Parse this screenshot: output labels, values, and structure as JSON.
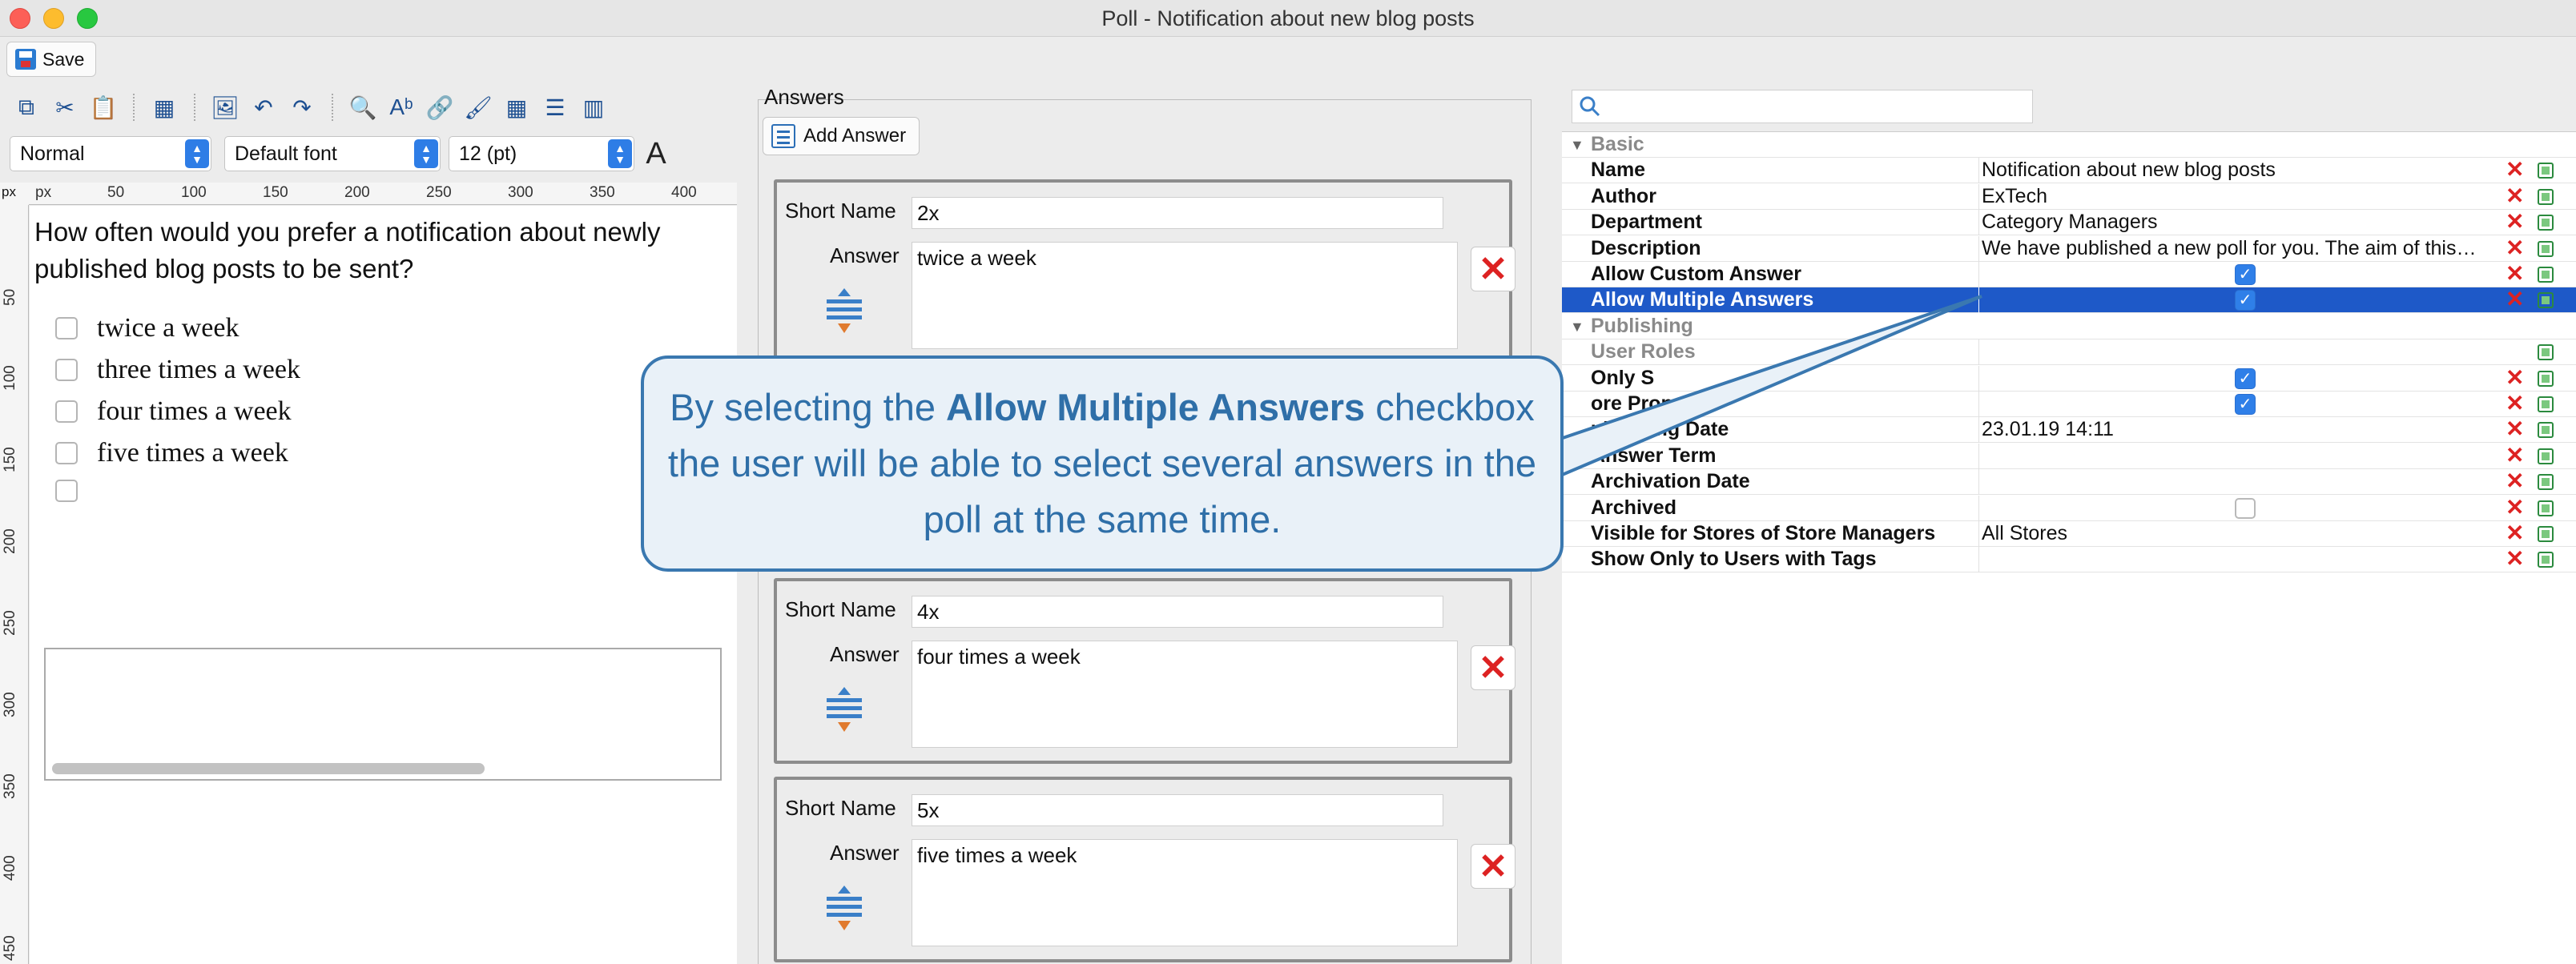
{
  "window": {
    "title": "Poll - Notification about new blog posts"
  },
  "toolbar": {
    "save_label": "Save"
  },
  "editor": {
    "style_select": "Normal",
    "font_select": "Default font",
    "size_select": "12 (pt)",
    "ruler_unit": "px",
    "ruler_h": [
      "50",
      "100",
      "150",
      "200",
      "250",
      "300",
      "350",
      "400"
    ],
    "ruler_v": [
      "50",
      "100",
      "150",
      "200",
      "250",
      "300",
      "350",
      "400",
      "450"
    ],
    "question": "How often would you prefer a notification about newly published blog posts to be sent?",
    "options": [
      "twice a week",
      "three times a week",
      "four times a week",
      "five times a week",
      ""
    ]
  },
  "answers": {
    "title": "Answers",
    "add_label": "Add Answer",
    "short_name_label": "Short Name",
    "answer_label": "Answer",
    "cards": [
      {
        "short_name": "2x",
        "answer": "twice a week"
      },
      {
        "short_name": "4x",
        "answer": "four times a week"
      },
      {
        "short_name": "5x",
        "answer": "five times a week"
      }
    ]
  },
  "properties": {
    "search_placeholder": "",
    "rows": [
      {
        "type": "group",
        "name": "Basic"
      },
      {
        "name": "Name",
        "value": "Notification about new blog posts",
        "x": true
      },
      {
        "name": "Author",
        "value": "ExTech",
        "x": true
      },
      {
        "name": "Department",
        "value": "Category Managers",
        "x": true
      },
      {
        "name": "Description",
        "value": "We have published a new poll for you. The aim of this…",
        "x": true
      },
      {
        "name": "Allow Custom Answer",
        "check": "on",
        "x": true
      },
      {
        "name": "Allow Multiple Answers",
        "check": "on",
        "x": true,
        "selected": true
      },
      {
        "type": "group",
        "name": "Publishing"
      },
      {
        "name": "User Roles",
        "value": "",
        "x": false,
        "disabled": true
      },
      {
        "name": "Only S",
        "check": "on",
        "x": true
      },
      {
        "name": "ore Property",
        "check": "on",
        "x": true
      },
      {
        "name": "ublishing Date",
        "value": "23.01.19 14:11",
        "x": true
      },
      {
        "name": "Answer Term",
        "value": "",
        "x": true
      },
      {
        "name": "Archivation Date",
        "value": "",
        "x": true
      },
      {
        "name": "Archived",
        "check": "off",
        "x": true
      },
      {
        "name": "Visible for Stores of Store Managers",
        "value": "All Stores",
        "x": true
      },
      {
        "name": "Show Only to Users with Tags",
        "value": "",
        "x": true
      }
    ]
  },
  "callout": {
    "before": "By selecting the ",
    "bold": "Allow Multiple Answers",
    "after": " checkbox the user will be able to select several answers in the poll at the same time."
  },
  "colors": {
    "accent": "#2f7fe8",
    "selection": "#1e59c8",
    "callout_border": "#3a78b0",
    "callout_text": "#2f6fa8",
    "delete": "#d22222"
  }
}
